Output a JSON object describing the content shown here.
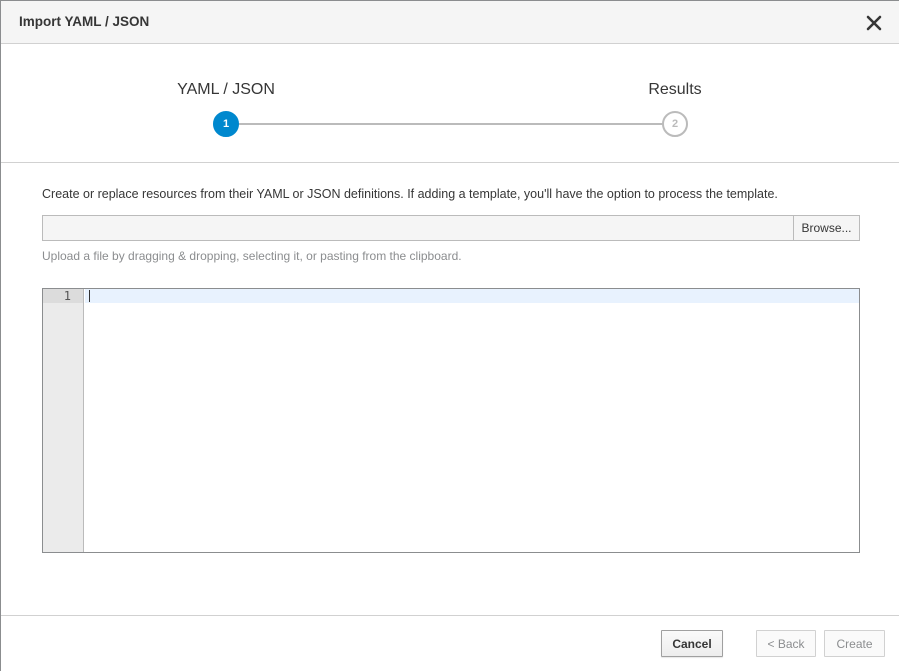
{
  "modal": {
    "title": "Import YAML / JSON",
    "close_icon": "close-icon"
  },
  "wizard": {
    "steps": [
      {
        "label": "YAML / JSON",
        "number": "1",
        "state": "active"
      },
      {
        "label": "Results",
        "number": "2",
        "state": "inactive"
      }
    ]
  },
  "body": {
    "help_text": "Create or replace resources from their YAML or JSON definitions. If adding a template, you'll have the option to process the template.",
    "file_input_value": "",
    "browse_label": "Browse...",
    "upload_hint": "Upload a file by dragging & dropping, selecting it, or pasting from the clipboard."
  },
  "editor": {
    "line_numbers": [
      "1"
    ],
    "content": ""
  },
  "footer": {
    "cancel_label": "Cancel",
    "back_label": "< Back",
    "create_label": "Create"
  },
  "colors": {
    "accent": "#0088ce",
    "header_bg": "#f5f5f5",
    "disabled_text": "#8b8d8f"
  }
}
